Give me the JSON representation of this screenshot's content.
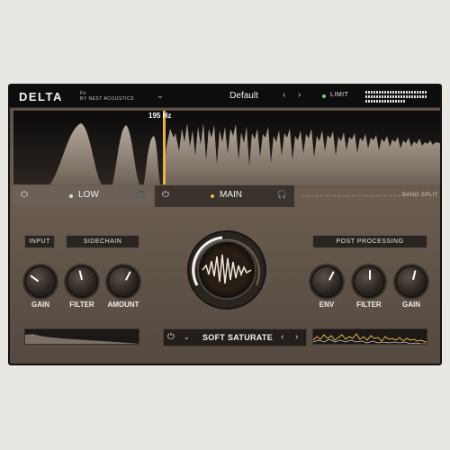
{
  "header": {
    "logo": "DELTA",
    "maker_line1": "Fn",
    "maker_line2": "BY NEST ACOUSTICS",
    "menu_icon": "chevron-down-icon",
    "preset": "Default",
    "prev": "‹",
    "next": "›",
    "limit_label": "LIMIT"
  },
  "spectrum": {
    "freq": "195 Hz"
  },
  "bands": {
    "low": {
      "label": "LOW"
    },
    "main": {
      "label": "MAIN"
    },
    "split_label": "BAND SPLIT"
  },
  "left": {
    "input": "INPUT",
    "sidechain": "SIDECHAIN",
    "knobs": [
      {
        "label": "GAIN",
        "level": 0.3
      },
      {
        "label": "FILTER",
        "level": 0.45
      },
      {
        "label": "AMOUNT",
        "level": 0.6
      }
    ]
  },
  "right": {
    "post": "POST PROCESSING",
    "knobs": [
      {
        "label": "ENV",
        "level": 0.6
      },
      {
        "label": "FILTER",
        "level": 0.5
      },
      {
        "label": "GAIN",
        "level": 0.55
      }
    ]
  },
  "center": {
    "mode": "SOFT SATURATE",
    "prev": "‹",
    "next": "›"
  },
  "colors": {
    "accent": "#e7b444",
    "bg": "#5a4f45"
  }
}
